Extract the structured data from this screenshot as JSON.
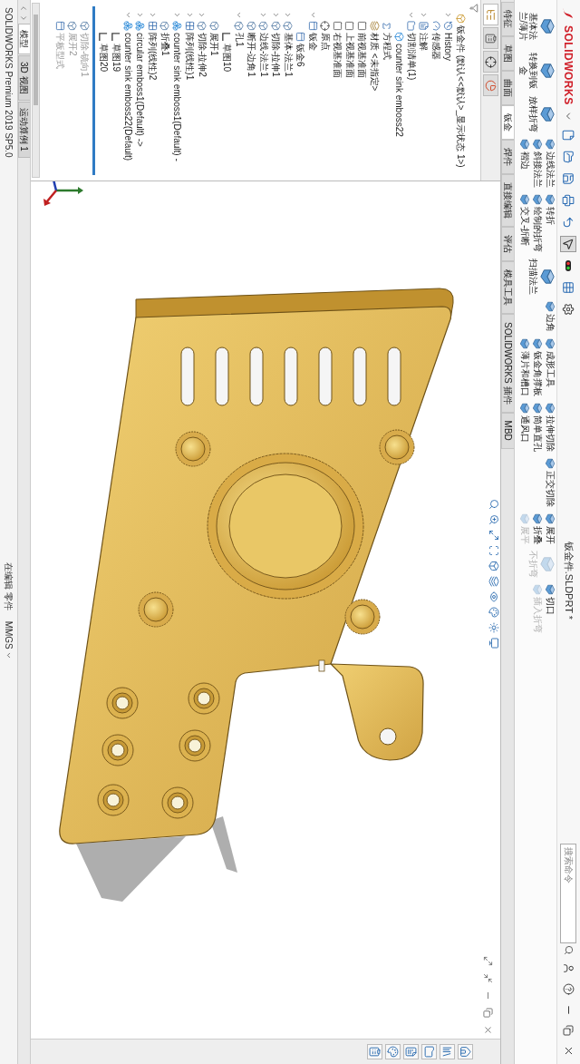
{
  "window": {
    "logo": "SOLIDWORKS",
    "title": "钣金件.SLDPRT *"
  },
  "search": {
    "placeholder": "搜索命令"
  },
  "ribbon": {
    "columns": [
      {
        "kind": "large",
        "items": [
          {
            "label": "基体法兰/薄片",
            "disabled": false
          }
        ]
      },
      {
        "kind": "large",
        "items": [
          {
            "label": "转换到钣金",
            "disabled": false
          }
        ]
      },
      {
        "kind": "large",
        "items": [
          {
            "label": "放样折弯",
            "disabled": false
          }
        ]
      },
      {
        "kind": "stack",
        "items": [
          {
            "label": "边线法兰",
            "disabled": false
          },
          {
            "label": "斜接法兰",
            "disabled": false
          },
          {
            "label": "褶边",
            "disabled": false
          }
        ]
      },
      {
        "kind": "stack",
        "items": [
          {
            "label": "转折",
            "disabled": false
          },
          {
            "label": "绘制的折弯",
            "disabled": false
          },
          {
            "label": "交叉-折断",
            "disabled": false
          }
        ]
      },
      {
        "kind": "large",
        "items": [
          {
            "label": "扫描法兰",
            "disabled": false
          }
        ]
      },
      {
        "kind": "stack",
        "items": [
          {
            "label": "边角",
            "disabled": false
          }
        ]
      },
      {
        "kind": "stack",
        "items": [
          {
            "label": "成形工具",
            "disabled": false
          },
          {
            "label": "钣金角撑板",
            "disabled": false
          },
          {
            "label": "薄片和槽口",
            "disabled": false
          }
        ]
      },
      {
        "kind": "stack",
        "items": [
          {
            "label": "拉伸切除",
            "disabled": false
          },
          {
            "label": "简单直孔",
            "disabled": false
          },
          {
            "label": "通风口",
            "disabled": false
          }
        ]
      },
      {
        "kind": "stack",
        "items": [
          {
            "label": "正交切除",
            "disabled": false
          }
        ]
      },
      {
        "kind": "stack",
        "items": [
          {
            "label": "展开",
            "disabled": false
          },
          {
            "label": "折叠",
            "disabled": false
          },
          {
            "label": "展平",
            "disabled": true
          }
        ]
      },
      {
        "kind": "large",
        "items": [
          {
            "label": "不折弯",
            "disabled": true
          }
        ]
      },
      {
        "kind": "stack",
        "items": [
          {
            "label": "切口",
            "disabled": false
          },
          {
            "label": "插入折弯",
            "disabled": true
          }
        ]
      }
    ]
  },
  "ribbon_tabs": [
    {
      "label": "特征",
      "selected": false
    },
    {
      "label": "草图",
      "selected": false
    },
    {
      "label": "曲面",
      "selected": false
    },
    {
      "label": "钣金",
      "selected": true
    },
    {
      "label": "焊件",
      "selected": false
    },
    {
      "label": "直接编辑",
      "selected": false
    },
    {
      "label": "评估",
      "selected": false
    },
    {
      "label": "模具工具",
      "selected": false
    },
    {
      "label": "SOLIDWORKS 插件",
      "selected": false
    },
    {
      "label": "MBD",
      "selected": false
    }
  ],
  "feature_tree": {
    "items": [
      {
        "label": "钣金件 (默认<<默认>_显示状态 1>)",
        "kind": "part"
      },
      {
        "label": "History",
        "kind": "history",
        "expanded": false
      },
      {
        "label": "传感器",
        "kind": "sensor"
      },
      {
        "label": "注解",
        "kind": "annotation",
        "expanded": false
      },
      {
        "label": "切割清单(1)",
        "kind": "folder",
        "expanded": true,
        "children": [
          {
            "label": "counter sink emboss22",
            "kind": "body"
          }
        ]
      },
      {
        "label": "方程式",
        "kind": "equation"
      },
      {
        "label": "材质 <未指定>",
        "kind": "material"
      },
      {
        "label": "前视基准面",
        "kind": "plane"
      },
      {
        "label": "上视基准面",
        "kind": "plane"
      },
      {
        "label": "右视基准面",
        "kind": "plane"
      },
      {
        "label": "原点",
        "kind": "origin"
      },
      {
        "label": "钣金",
        "kind": "sheetmetal",
        "expanded": true,
        "children": [
          {
            "label": "钣金6",
            "kind": "sheetmetal"
          }
        ]
      },
      {
        "label": "基体-法兰1",
        "kind": "feature",
        "expanded": false
      },
      {
        "label": "切除-拉伸1",
        "kind": "feature",
        "expanded": false
      },
      {
        "label": "边线-法兰1",
        "kind": "feature",
        "expanded": false
      },
      {
        "label": "断开-边角1",
        "kind": "feature"
      },
      {
        "label": "孔1",
        "kind": "feature",
        "expanded": true,
        "children": [
          {
            "label": "草图10",
            "kind": "sketch"
          }
        ]
      },
      {
        "label": "展开1",
        "kind": "feature"
      },
      {
        "label": "切除-拉伸2",
        "kind": "feature",
        "expanded": false
      },
      {
        "label": "阵列(线性)1",
        "kind": "pattern",
        "expanded": false
      },
      {
        "label": "counter sink emboss1(Default) -",
        "kind": "library",
        "expanded": false
      },
      {
        "label": "折叠1",
        "kind": "feature"
      },
      {
        "label": "阵列(线性)2",
        "kind": "pattern",
        "expanded": false
      },
      {
        "label": "circular emboss1(Default) ->",
        "kind": "library",
        "expanded": false
      },
      {
        "label": "counter sink emboss22(Default)",
        "kind": "library",
        "expanded": true,
        "children": [
          {
            "label": "草图19",
            "kind": "sketch"
          },
          {
            "label": "草图20",
            "kind": "sketch"
          }
        ]
      }
    ],
    "rolled_back_items": [
      {
        "label": "切除-镜向1",
        "kind": "feature"
      },
      {
        "label": "展开2",
        "kind": "feature"
      },
      {
        "label": "平板型式",
        "kind": "sheetmetal"
      }
    ]
  },
  "panel_tabs": [
    {
      "selected": true
    },
    {
      "selected": false
    },
    {
      "selected": false
    },
    {
      "selected": false
    }
  ],
  "model_tabs": [
    {
      "label": "模型",
      "selected": true
    },
    {
      "label": "3D 视图",
      "selected": false
    },
    {
      "label": "运动算例 1",
      "selected": false
    }
  ],
  "status_bar": {
    "product": "SOLIDWORKS Premium 2019 SP5.0",
    "mode": "在编辑 零件",
    "units": "MMGS"
  }
}
